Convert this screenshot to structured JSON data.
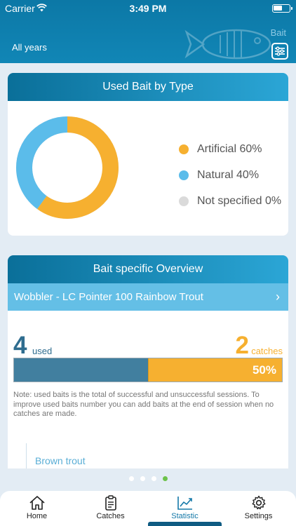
{
  "status_bar": {
    "carrier": "Carrier",
    "time": "3:49 PM"
  },
  "header": {
    "period": "All years",
    "section": "Bait"
  },
  "colors": {
    "artificial": "#f6b030",
    "natural": "#5bbcea",
    "not_specified": "#dadada",
    "accent": "#1378a8"
  },
  "bait_type_card": {
    "title": "Used Bait by Type",
    "legend": [
      {
        "label": "Artificial 60%",
        "value": 60
      },
      {
        "label": "Natural 40%",
        "value": 40
      },
      {
        "label": "Not specified 0%",
        "value": 0
      }
    ]
  },
  "overview_card": {
    "title": "Bait specific Overview",
    "selected_bait": "Wobbler - LC Pointer 100 Rainbow Trout",
    "used_count": "4",
    "used_label": "used",
    "catches_count": "2",
    "catches_label": "catches",
    "catch_rate": "50%",
    "catch_rate_fraction": 0.5,
    "note": "Note: used baits is the total of successful and unsuccessful sessions. To improve used baits number you can add baits at the end of session when no catches are made.",
    "species": "Brown trout"
  },
  "pager": {
    "count": 4,
    "active": 3
  },
  "tabs": [
    {
      "label": "Home",
      "icon": "home-icon"
    },
    {
      "label": "Catches",
      "icon": "clipboard-icon"
    },
    {
      "label": "Statistic",
      "icon": "chart-icon"
    },
    {
      "label": "Settings",
      "icon": "gear-icon"
    }
  ],
  "active_tab": 2
}
